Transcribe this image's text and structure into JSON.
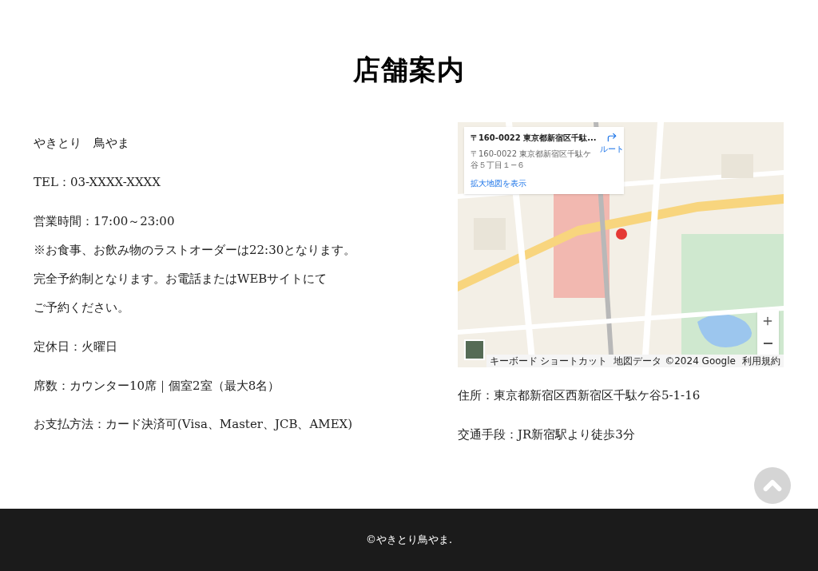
{
  "title": "店舗案内",
  "info": [
    {
      "kind": "line",
      "text": "やきとり　鳥やま"
    },
    {
      "kind": "line",
      "text": "TEL：03-XXXX-XXXX"
    },
    {
      "kind": "block",
      "lines": [
        "営業時間：17:00～23:00",
        "※お食事、お飲み物のラストオーダーは22:30となります。",
        "完全予約制となります。お電話またはWEBサイトにて",
        "ご予約ください。"
      ]
    },
    {
      "kind": "line",
      "text": "定休日：火曜日"
    },
    {
      "kind": "line",
      "text": "席数：カウンター10席｜個室2室（最大8名）"
    },
    {
      "kind": "line",
      "text": "お支払方法：カード決済可(Visa、Master、JCB、AMEX)"
    }
  ],
  "map": {
    "card": {
      "title": "〒160-0022 東京都新宿区千駄...",
      "address": "〒160-0022 東京都新宿区千駄ケ谷５丁目１−６",
      "route": "ルート",
      "link": "拡大地図を表示"
    },
    "attribution": [
      "キーボード ショートカット",
      "地図データ ©2024 Google",
      "利用規約"
    ]
  },
  "access": [
    "住所：東京都新宿区西新宿区千駄ケ谷5-1-16",
    "交通手段：JR新宿駅より徒歩3分"
  ],
  "footer": "©やきとり鳥やま."
}
